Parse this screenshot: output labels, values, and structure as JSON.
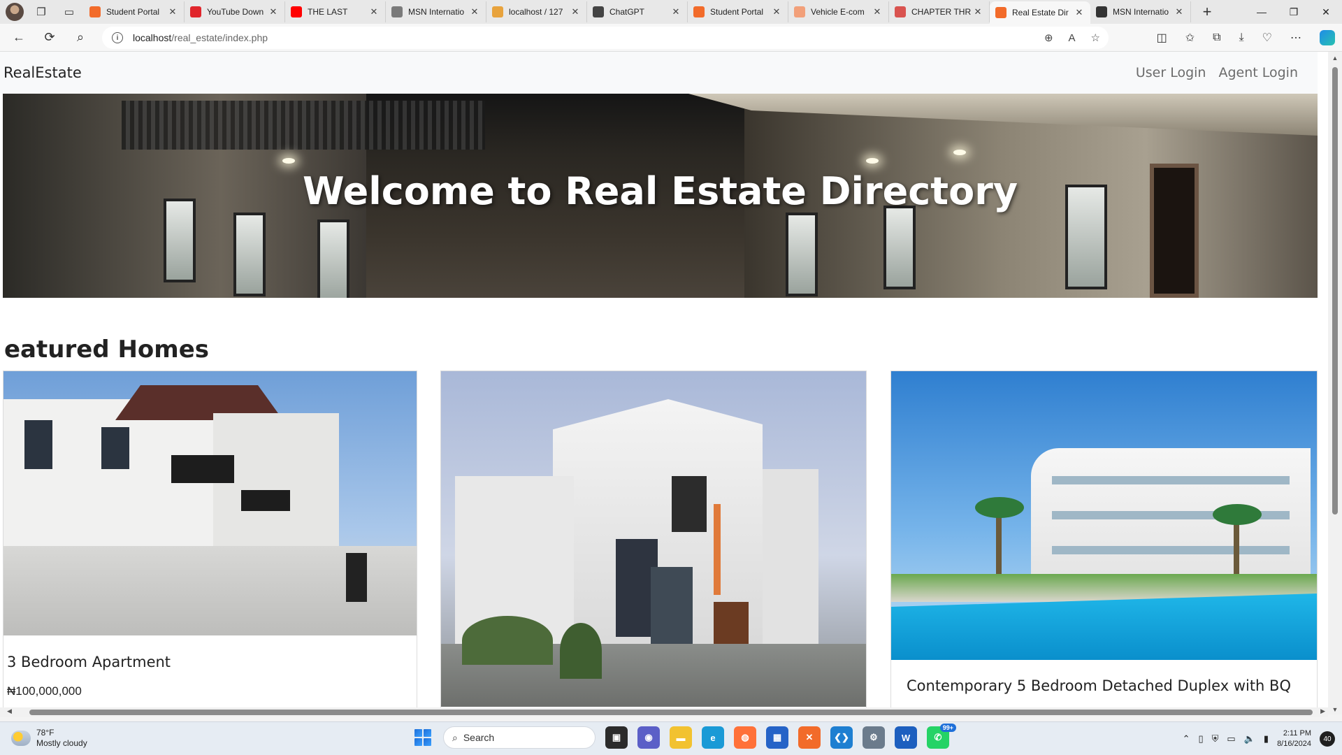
{
  "browser": {
    "tabs": [
      {
        "title": "Student Portal",
        "icon": "xampp-icon",
        "color": "#f26b2a"
      },
      {
        "title": "YouTube Down",
        "icon": "download-icon",
        "color": "#e0262c"
      },
      {
        "title": "THE LAST",
        "icon": "youtube-icon",
        "color": "#ff0000"
      },
      {
        "title": "MSN Internatio",
        "icon": "msn-icon",
        "color": "#7a7a7a"
      },
      {
        "title": "localhost / 127",
        "icon": "phpmyadmin-icon",
        "color": "#e8a33d"
      },
      {
        "title": "ChatGPT",
        "icon": "chatgpt-icon",
        "color": "#444444"
      },
      {
        "title": "Student Portal",
        "icon": "xampp-icon",
        "color": "#f26b2a"
      },
      {
        "title": "Vehicle E-com",
        "icon": "xampp-icon",
        "color": "#f2a07a"
      },
      {
        "title": "CHAPTER THR",
        "icon": "pdf-icon",
        "color": "#d9534f"
      },
      {
        "title": "Real Estate Dir",
        "icon": "xampp-icon",
        "color": "#f26b2a",
        "active": true
      },
      {
        "title": "MSN Internatio",
        "icon": "msn-icon",
        "color": "#333333"
      }
    ],
    "url_host": "localhost",
    "url_path": "/real_estate/index.php"
  },
  "site": {
    "brand": "RealEstate",
    "nav": {
      "user_login": "User Login",
      "agent_login": "Agent Login"
    },
    "hero_title": "Welcome to Real Estate Directory",
    "section_title": "eatured Homes",
    "cards": [
      {
        "title": "3 Bedroom Apartment",
        "price": "₦100,000,000"
      },
      {
        "title": "",
        "price": ""
      },
      {
        "title": "Contemporary 5 Bedroom Detached Duplex with BQ",
        "price": ""
      }
    ]
  },
  "taskbar": {
    "weather_temp": "78°F",
    "weather_desc": "Mostly cloudy",
    "search_placeholder": "Search",
    "whatsapp_badge": "99+",
    "time": "2:11 PM",
    "date": "8/16/2024",
    "notifications": "40"
  },
  "colors": {
    "navbar_bg": "#f8f9fa",
    "nav_link": "#6b6b6b",
    "accent": "#1e6fd9"
  }
}
